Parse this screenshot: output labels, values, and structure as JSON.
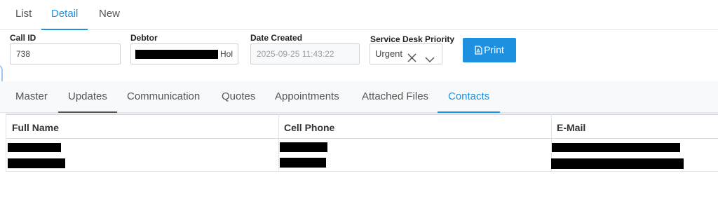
{
  "top_tabs": [
    {
      "label": "List"
    },
    {
      "label": "Detail",
      "active": true
    },
    {
      "label": "New"
    }
  ],
  "fields": {
    "call_id": {
      "label": "Call ID",
      "value": "738"
    },
    "debtor": {
      "label": "Debtor",
      "value_suffix": "Hol"
    },
    "date_created": {
      "label": "Date Created",
      "value": "2025-09-25 11:43:22"
    },
    "priority": {
      "label": "Service Desk Priority",
      "value": "Urgent"
    }
  },
  "print_button": {
    "label": "Print",
    "icon": "pdf-file-icon"
  },
  "section_tabs": [
    {
      "label": "Master"
    },
    {
      "label": "Updates"
    },
    {
      "label": "Communication"
    },
    {
      "label": "Quotes"
    },
    {
      "label": "Appointments"
    },
    {
      "label": "Attached Files"
    },
    {
      "label": "Contacts",
      "active": true
    }
  ],
  "contacts_table": {
    "columns": [
      "Full Name",
      "Cell Phone",
      "E-Mail"
    ]
  },
  "colors": {
    "accent": "#1e90e0",
    "text": "#333333",
    "border": "#e2e6ea"
  }
}
